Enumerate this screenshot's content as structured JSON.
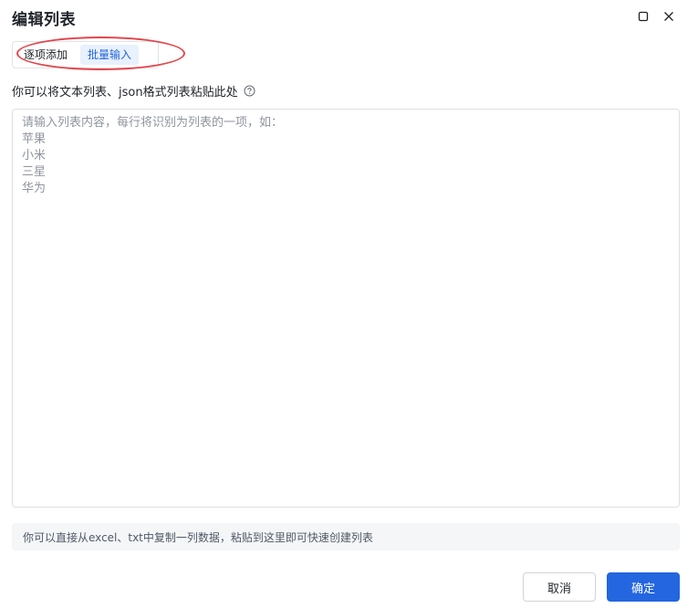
{
  "dialog": {
    "title": "编辑列表",
    "tabs": [
      {
        "label": "逐项添加",
        "active": false
      },
      {
        "label": "批量输入",
        "active": true
      }
    ],
    "hint": "你可以将文本列表、json格式列表粘贴此处",
    "textarea": {
      "placeholder_lines": [
        "请输入列表内容，每行将识别为列表的一项，如：",
        "苹果",
        "小米",
        "三星",
        "华为"
      ]
    },
    "tip": "你可以直接从excel、txt中复制一列数据，粘贴到这里即可快速创建列表",
    "buttons": {
      "cancel": "取消",
      "confirm": "确定"
    }
  },
  "icons": {
    "maximize": "maximize-icon",
    "close": "close-icon",
    "help": "help-circle-icon"
  },
  "colors": {
    "primary": "#2366e0",
    "tab_active_bg": "#e8f1fd",
    "annotation": "#e4444a",
    "tip_bg": "#f5f6f7"
  }
}
